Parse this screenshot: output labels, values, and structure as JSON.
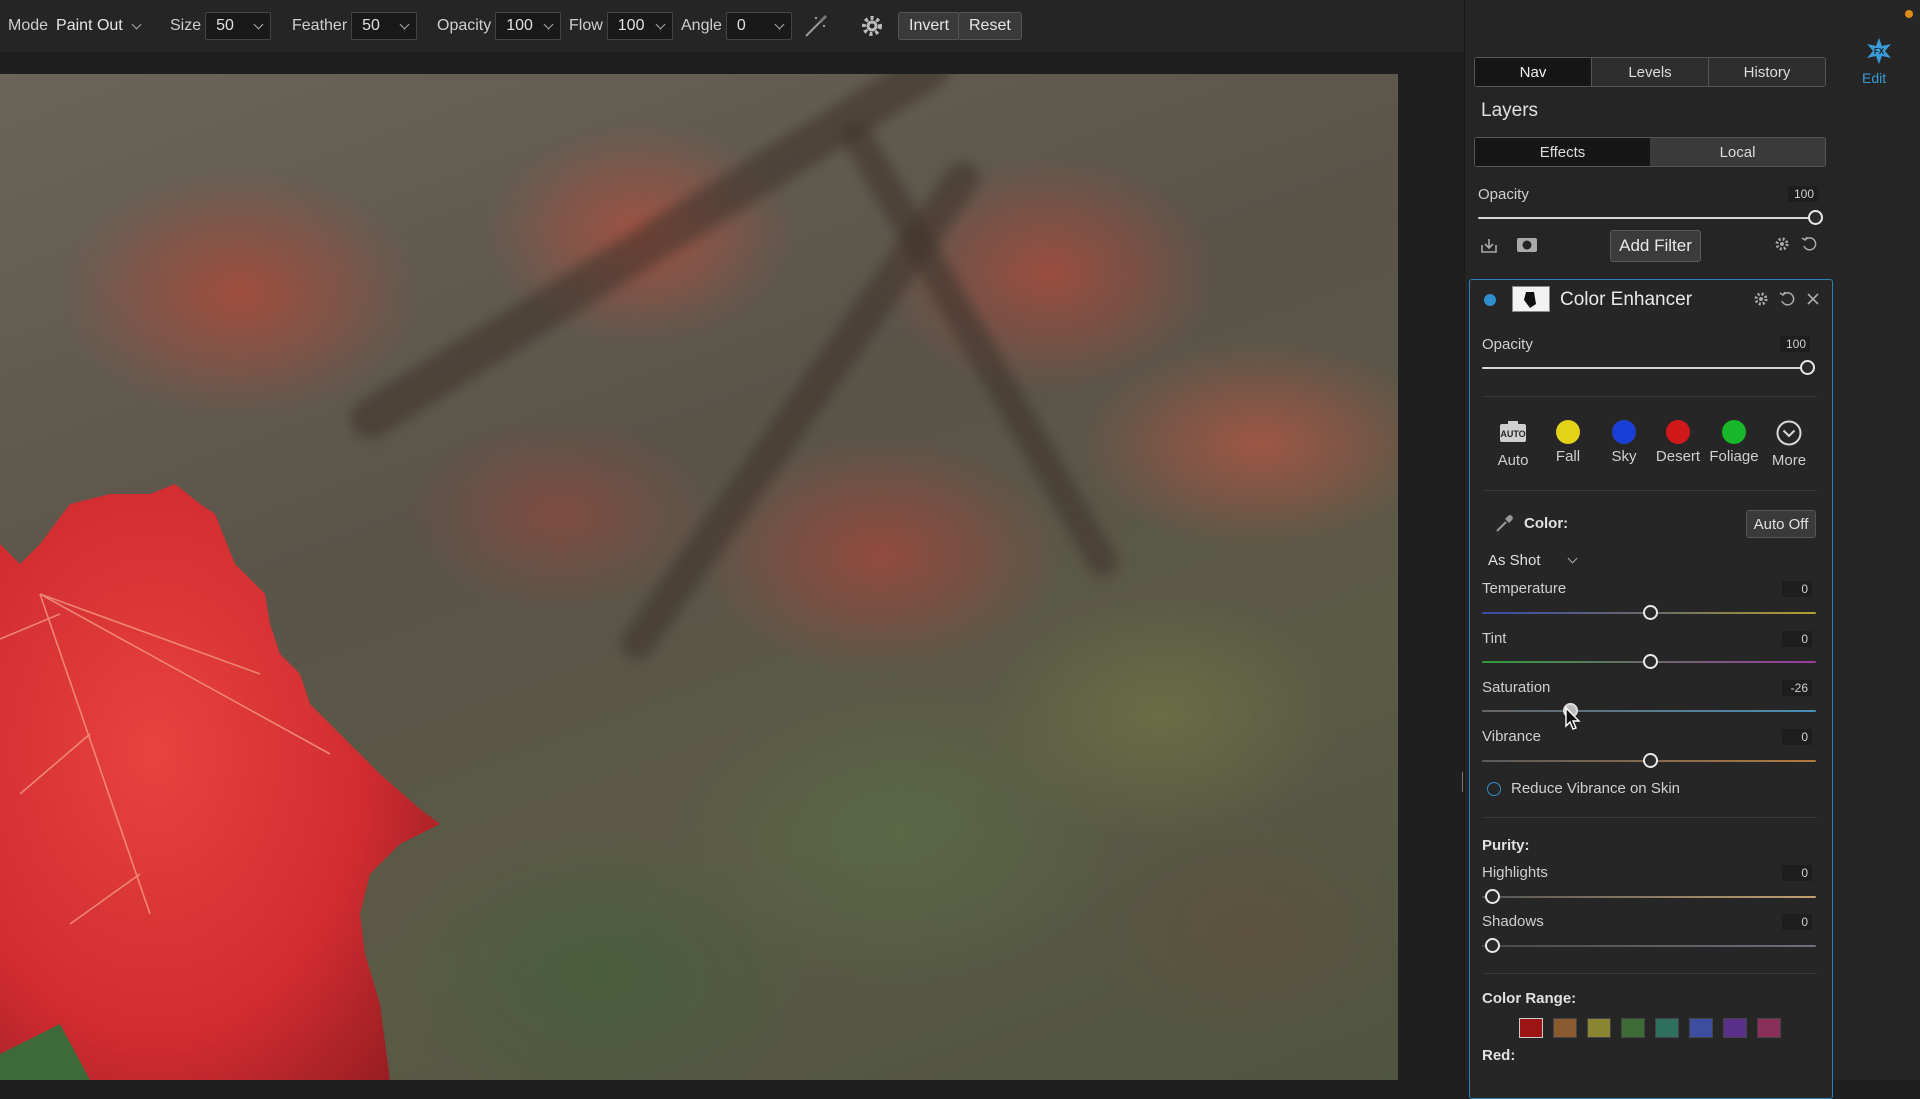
{
  "toolbar": {
    "mode_label": "Mode",
    "mode_value": "Paint Out",
    "size_label": "Size",
    "size_value": "50",
    "feather_label": "Feather",
    "feather_value": "50",
    "opacity_label": "Opacity",
    "opacity_value": "100",
    "flow_label": "Flow",
    "flow_value": "100",
    "angle_label": "Angle",
    "angle_value": "0",
    "invert_label": "Invert",
    "reset_label": "Reset"
  },
  "nav_tabs": [
    "Nav",
    "Levels",
    "History"
  ],
  "layers": {
    "title": "Layers",
    "tabs": [
      "Effects",
      "Local"
    ],
    "opacity_label": "Opacity",
    "opacity_value": "100",
    "add_filter_label": "Add Filter"
  },
  "rail": {
    "edit_label": "Edit"
  },
  "filter": {
    "title": "Color Enhancer",
    "opacity_label": "Opacity",
    "opacity_value": "100",
    "presets": [
      {
        "label": "Auto",
        "icon": "auto-icon"
      },
      {
        "label": "Fall",
        "color": "#e2d21a"
      },
      {
        "label": "Sky",
        "color": "#1a3fd6"
      },
      {
        "label": "Desert",
        "color": "#d01818"
      },
      {
        "label": "Foliage",
        "color": "#18b82a"
      },
      {
        "label": "More",
        "icon": "chevron-circle-icon"
      }
    ],
    "color_label": "Color:",
    "auto_off_label": "Auto Off",
    "white_balance": "As Shot",
    "temperature_label": "Temperature",
    "temperature_value": "0",
    "tint_label": "Tint",
    "tint_value": "0",
    "saturation_label": "Saturation",
    "saturation_value": "-26",
    "vibrance_label": "Vibrance",
    "vibrance_value": "0",
    "reduce_vibrance_label": "Reduce Vibrance on Skin",
    "purity_label": "Purity:",
    "highlights_label": "Highlights",
    "highlights_value": "0",
    "shadows_label": "Shadows",
    "shadows_value": "0",
    "color_range_label": "Color Range:",
    "color_range_swatches": [
      "#9c1414",
      "#8a5a30",
      "#8a8530",
      "#3e6a36",
      "#2f6f5e",
      "#3d4ea0",
      "#5a2f8a",
      "#8a2f5a"
    ],
    "red_label": "Red:"
  },
  "accent": "#2b80b5"
}
